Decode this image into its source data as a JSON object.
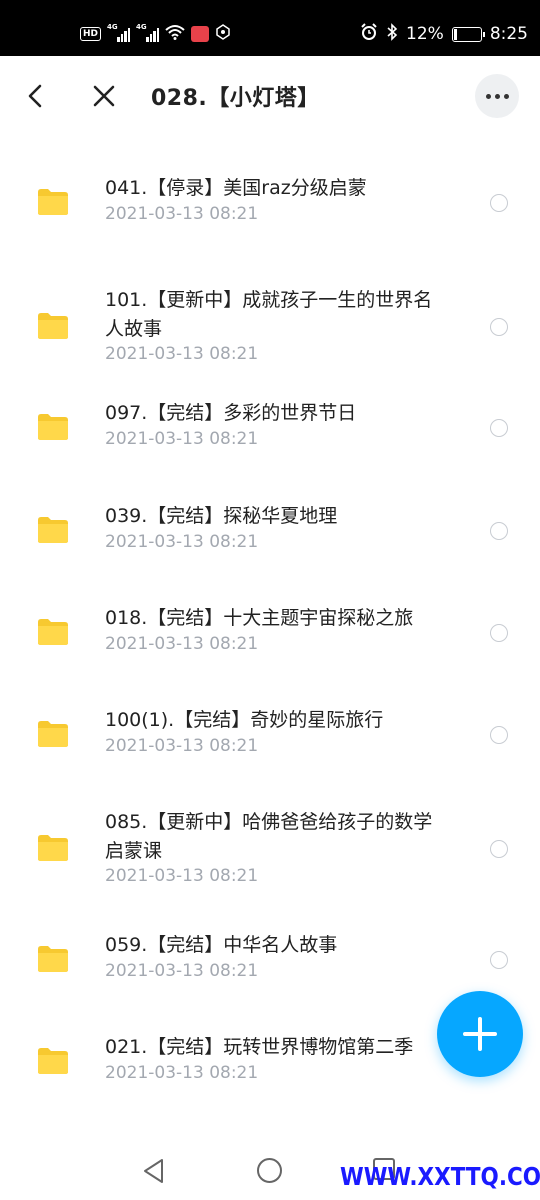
{
  "status_bar": {
    "hd_label": "HD",
    "sim1_label": "4G",
    "sim2_label": "4G",
    "battery_percent": "12%",
    "battery_level": 0.12,
    "time": "8:25",
    "icons": [
      "hd-icon",
      "signal-icon",
      "signal-icon",
      "wifi-icon",
      "app-notification-icon",
      "location-icon",
      "alarm-icon",
      "bluetooth-icon",
      "battery-icon"
    ]
  },
  "header": {
    "title": "028.【小灯塔】",
    "back_icon": "chevron-left-icon",
    "close_icon": "close-icon",
    "more_icon": "more-horizontal-icon"
  },
  "files": [
    {
      "name": "041.【停录】美国raz分级启蒙",
      "date": "2021-03-13  08:21"
    },
    {
      "name": "101.【更新中】成就孩子一生的世界名人故事",
      "date": "2021-03-13  08:21"
    },
    {
      "name": "097.【完结】多彩的世界节日",
      "date": "2021-03-13  08:21"
    },
    {
      "name": "039.【完结】探秘华夏地理",
      "date": "2021-03-13  08:21"
    },
    {
      "name": "018.【完结】十大主题宇宙探秘之旅",
      "date": "2021-03-13  08:21"
    },
    {
      "name": "100(1).【完结】奇妙的星际旅行",
      "date": "2021-03-13  08:21"
    },
    {
      "name": "085.【更新中】哈佛爸爸给孩子的数学启蒙课",
      "date": "2021-03-13  08:21"
    },
    {
      "name": "059.【完结】中华名人故事",
      "date": "2021-03-13  08:21"
    },
    {
      "name": "021.【完结】玩转世界博物馆第二季",
      "date": "2021-03-13  08:21"
    }
  ],
  "colors": {
    "folder": "#ffd84a",
    "folder_tab": "#f7c930",
    "fab": "#06a7ff",
    "date_text": "#a3a8b0",
    "watermark": "#1a1aff"
  },
  "fab_icon": "plus-icon",
  "watermark": "WWW.XXTTQ.COM",
  "nav": {
    "icons": [
      "nav-back-icon",
      "nav-home-icon",
      "nav-recent-icon"
    ]
  }
}
